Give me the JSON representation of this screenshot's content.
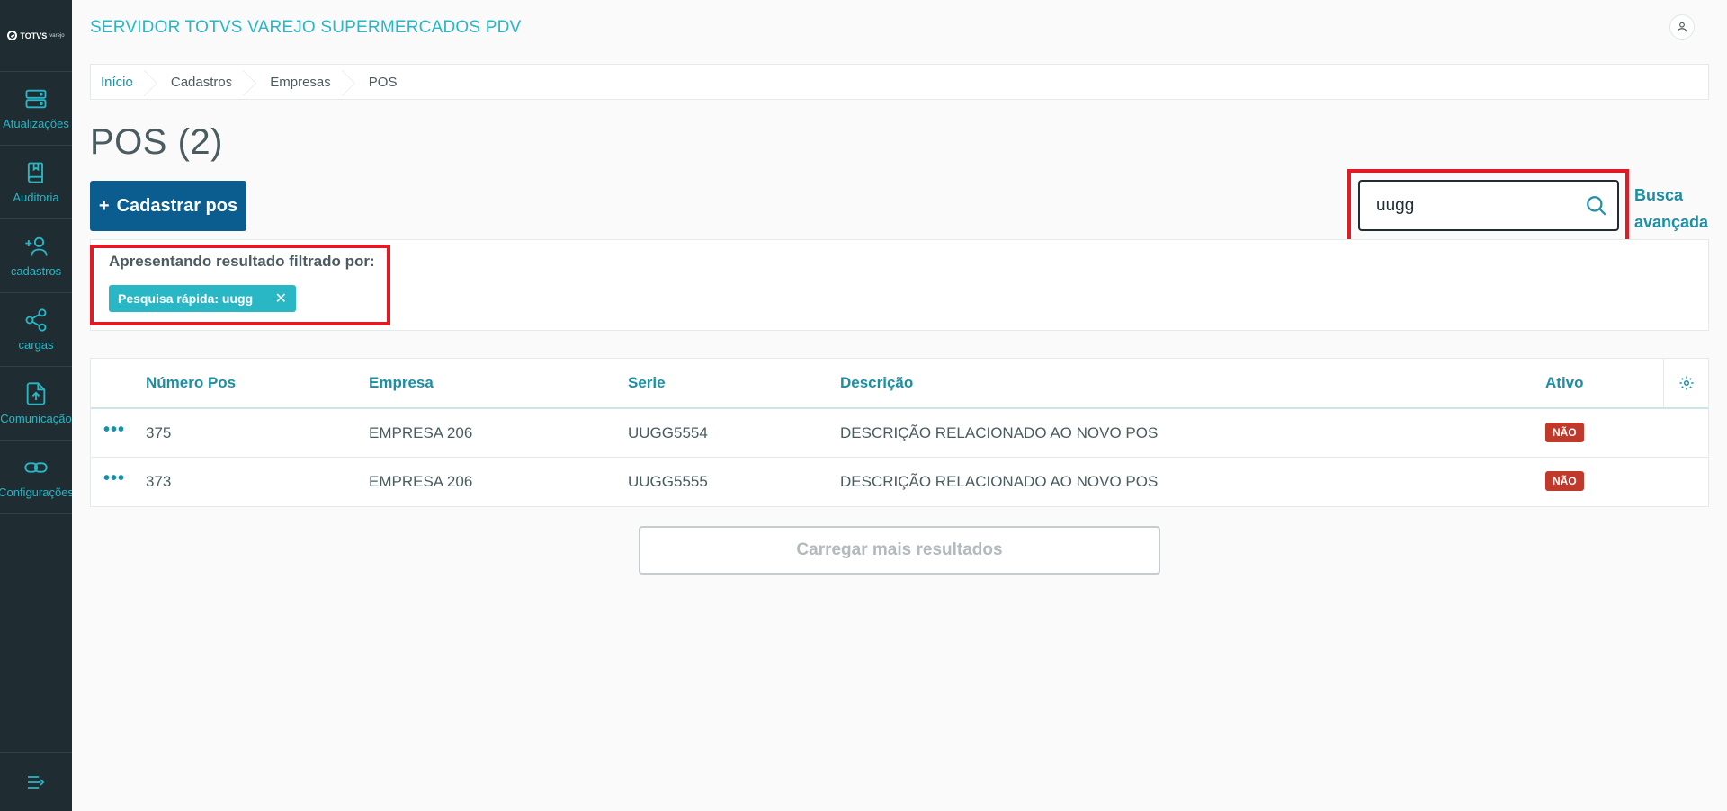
{
  "sidebar": {
    "logo_text": "TOTVS",
    "logo_sub": "varejo",
    "items": [
      {
        "label": "Atualizações"
      },
      {
        "label": "Auditoria"
      },
      {
        "label": "cadastros"
      },
      {
        "label": "cargas"
      },
      {
        "label": "Comunicação"
      },
      {
        "label": "Configurações"
      }
    ]
  },
  "header": {
    "title": "SERVIDOR TOTVS VAREJO SUPERMERCADOS PDV"
  },
  "breadcrumb": [
    "Início",
    "Cadastros",
    "Empresas",
    "POS"
  ],
  "page": {
    "title": "POS (2)",
    "add_button": "Cadastrar pos",
    "add_icon": "+"
  },
  "search": {
    "value": "uugg",
    "advanced_line1": "Busca",
    "advanced_line2": "avançada"
  },
  "filter": {
    "label": "Apresentando resultado filtrado por:",
    "chip": "Pesquisa rápida: uugg",
    "chip_close": "✕"
  },
  "table": {
    "columns": [
      "Número Pos",
      "Empresa",
      "Serie",
      "Descrição",
      "Ativo"
    ],
    "rows": [
      {
        "numero": "375",
        "empresa": "EMPRESA 206",
        "serie": "UUGG5554",
        "descricao": "DESCRIÇÃO RELACIONADO AO NOVO POS",
        "ativo": "NÃO"
      },
      {
        "numero": "373",
        "empresa": "EMPRESA 206",
        "serie": "UUGG5555",
        "descricao": "DESCRIÇÃO RELACIONADO AO NOVO POS",
        "ativo": "NÃO"
      }
    ],
    "row_menu": "•••"
  },
  "load_more": "Carregar mais resultados",
  "colors": {
    "sidebar_bg": "#1f2d32",
    "accent": "#29b6c5",
    "link": "#1b8fa5",
    "primary_button": "#0c5d8f",
    "highlight": "#e01b26",
    "badge_no": "#c0392b"
  }
}
